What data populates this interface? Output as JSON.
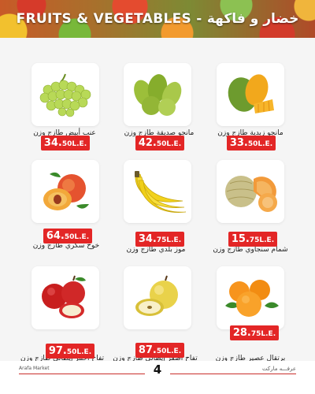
{
  "header": {
    "title": "FRUITS & VEGETABLES - خضار و فاكهة"
  },
  "products": [
    {
      "name": "عنب أبيض طازج وزن",
      "price_int": "34.",
      "price_dec": "50",
      "currency": "L.E."
    },
    {
      "name": "مانجو صديقة طازج وزن",
      "price_int": "42.",
      "price_dec": "50",
      "currency": "L.E."
    },
    {
      "name": "مانجو زبدية طازج وزن",
      "price_int": "33.",
      "price_dec": "50",
      "currency": "L.E."
    },
    {
      "name": "خوخ سكري طازج وزن",
      "price_int": "64.",
      "price_dec": "50",
      "currency": "L.E."
    },
    {
      "name": "موز بلدي طازج وزن",
      "price_int": "34.",
      "price_dec": "75",
      "currency": "L.E."
    },
    {
      "name": "شمام سنجاوي طازج وزن",
      "price_int": "15.",
      "price_dec": "75",
      "currency": "L.E."
    },
    {
      "name": "تفاح أحمر إيطالي طازج وزن",
      "price_int": "97.",
      "price_dec": "50",
      "currency": "L.E."
    },
    {
      "name": "تفاح أصفر إيطالي طازج وزن",
      "price_int": "87.",
      "price_dec": "50",
      "currency": "L.E."
    },
    {
      "name": "برتقال عصير طازج وزن",
      "price_int": "28.",
      "price_dec": "75",
      "currency": "L.E."
    }
  ],
  "footer": {
    "brand_en": "Arafa Market",
    "brand_ar": "عرفـــه ماركت",
    "page_number": "4"
  }
}
